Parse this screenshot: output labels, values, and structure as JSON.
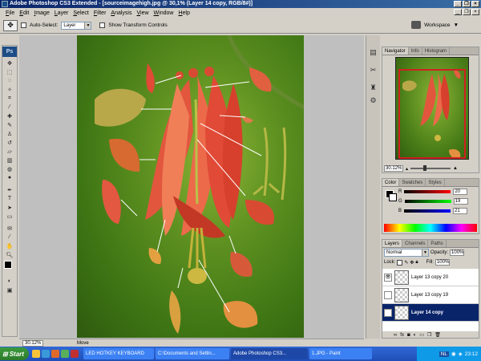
{
  "window": {
    "title": "Adobe Photoshop CS3 Extended - [sourceimagehigh.jpg @ 30,1% (Layer 14 copy, RGB/8#)]"
  },
  "menu": [
    "File",
    "Edit",
    "Image",
    "Layer",
    "Select",
    "Filter",
    "Analysis",
    "View",
    "Window",
    "Help"
  ],
  "options": {
    "auto_select_label": "Auto-Select:",
    "auto_select_value": "Layer",
    "show_transform_label": "Show Transform Controls",
    "workspace_label": "Workspace"
  },
  "toolbox": {
    "logo": "Ps"
  },
  "status": {
    "zoom": "30.12%",
    "info": "Move"
  },
  "navigator": {
    "tabs": [
      "Navigator",
      "Info",
      "Histogram"
    ],
    "zoom": "30.12%"
  },
  "color": {
    "tabs": [
      "Color",
      "Swatches",
      "Styles"
    ],
    "channels": [
      {
        "label": "R",
        "value": "20",
        "color": "#d02020"
      },
      {
        "label": "G",
        "value": "19",
        "color": "#20a020"
      },
      {
        "label": "B",
        "value": "21",
        "color": "#2040d0"
      }
    ]
  },
  "layers": {
    "tabs": [
      "Layers",
      "Channels",
      "Paths"
    ],
    "blend_mode": "Normal",
    "opacity_label": "Opacity:",
    "opacity": "100%",
    "lock_label": "Lock:",
    "fill_label": "Fill:",
    "fill": "100%",
    "items": [
      {
        "name": "Layer 13 copy 20",
        "visible": true,
        "active": false
      },
      {
        "name": "Layer 13 copy 19",
        "visible": false,
        "active": false
      },
      {
        "name": "Layer 14 copy",
        "visible": true,
        "active": true
      }
    ]
  },
  "taskbar": {
    "start": "Start",
    "tasks": [
      {
        "label": "LED HOTKEY KEYBOARD",
        "active": false
      },
      {
        "label": "C:\\Documents and Settin...",
        "active": false
      },
      {
        "label": "Adobe Photoshop CS3...",
        "active": true
      },
      {
        "label": "1.JPG - Paint",
        "active": false
      }
    ],
    "tray_lang": "NL",
    "clock": "23:12"
  },
  "colors": {
    "titlebar": "#0a246a",
    "selection": "#0a246a",
    "taskbar": "#245edb",
    "canvas_bg": "#bfbfbf"
  }
}
